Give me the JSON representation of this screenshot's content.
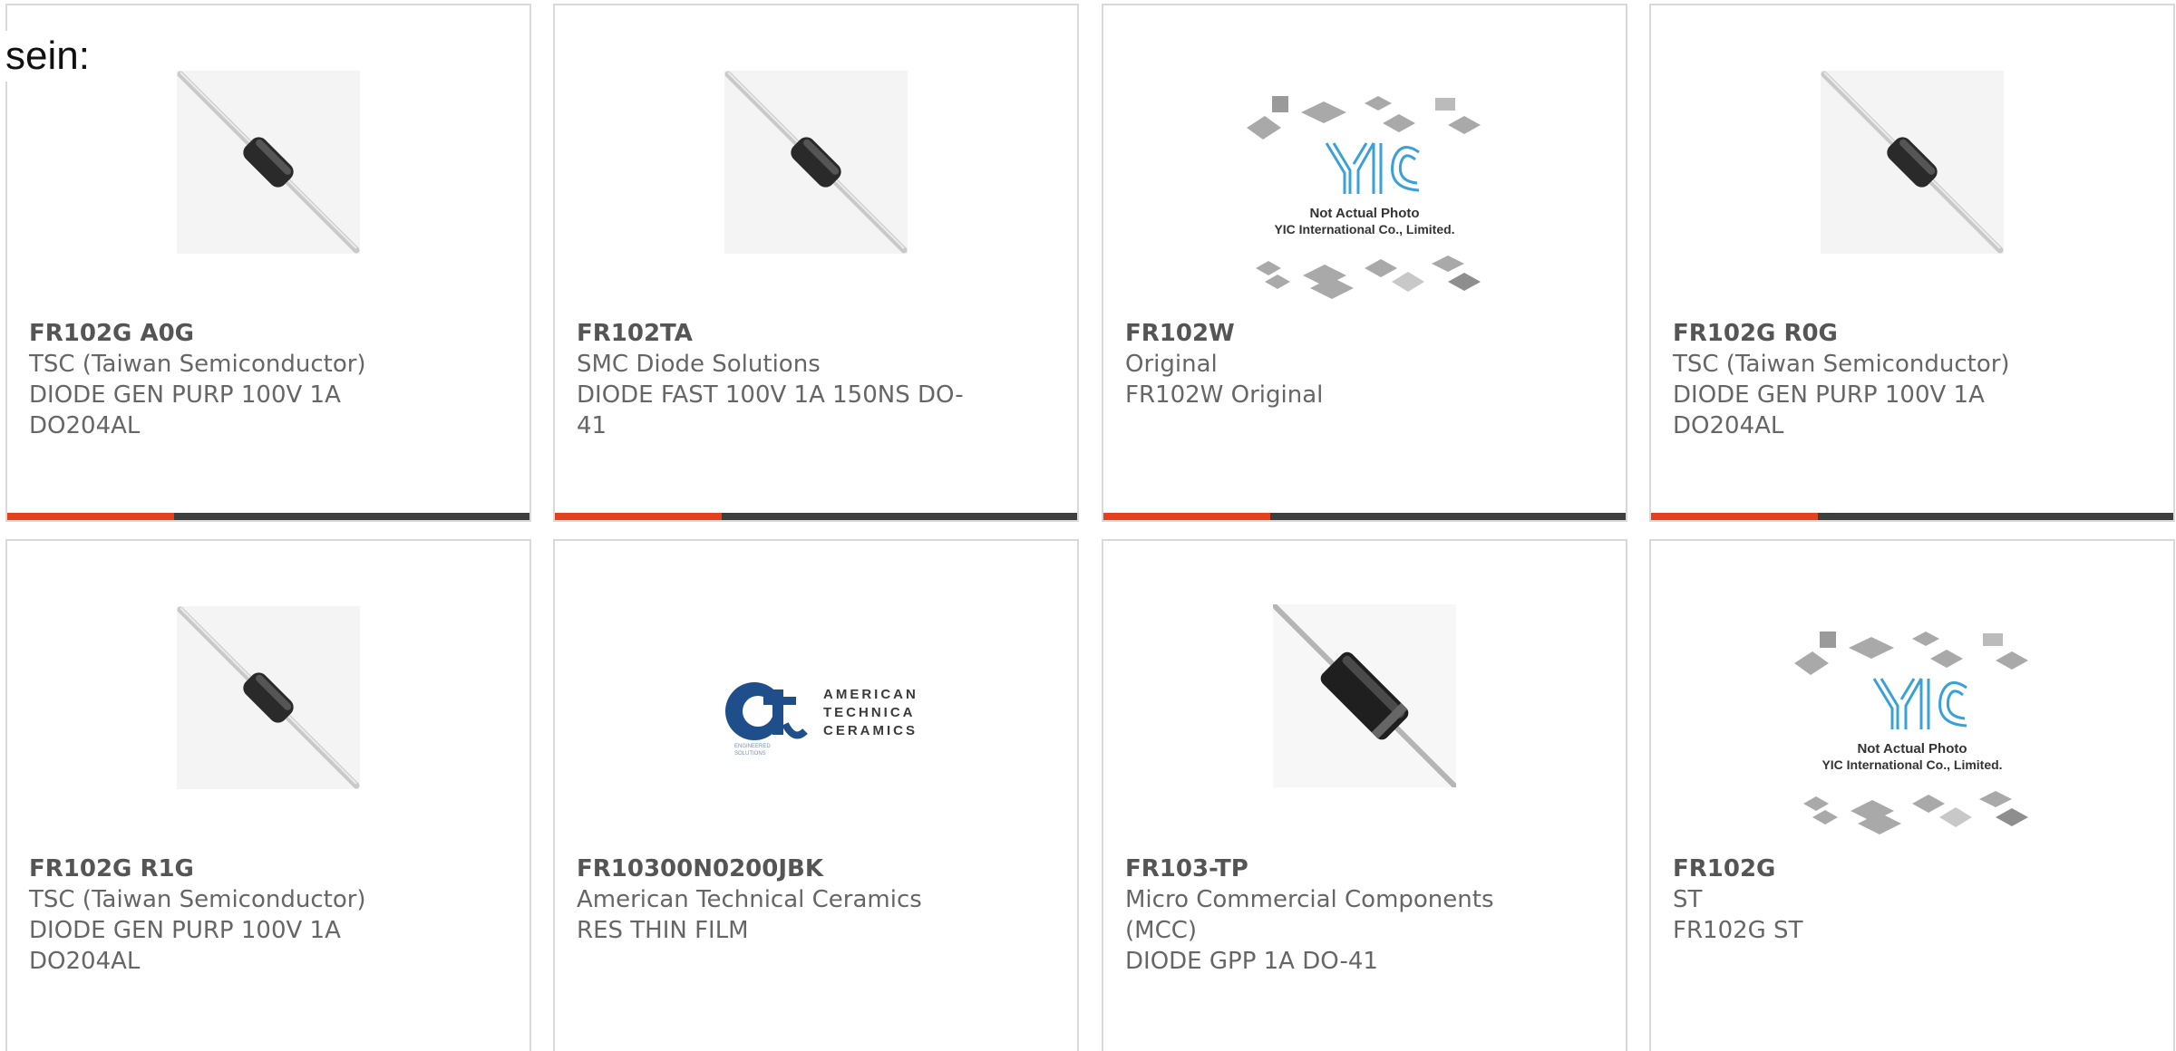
{
  "intro_text": "sein:",
  "colors": {
    "accent": "#e4421d",
    "bar": "#3e3e3e",
    "text": "#666666",
    "border": "#d9d9d9"
  },
  "products": [
    {
      "part": "FR102G A0G",
      "maker": "TSC (Taiwan Semiconductor)",
      "desc": "DIODE GEN PURP 100V 1A DO204AL",
      "image": "axial-diode-small"
    },
    {
      "part": "FR102TA",
      "maker": "SMC Diode Solutions",
      "desc": "DIODE FAST 100V 1A 150NS DO-41",
      "image": "axial-diode-small"
    },
    {
      "part": "FR102W",
      "maker": "Original",
      "desc": "FR102W Original",
      "image": "yic-placeholder"
    },
    {
      "part": "FR102G R0G",
      "maker": "TSC (Taiwan Semiconductor)",
      "desc": "DIODE GEN PURP 100V 1A DO204AL",
      "image": "axial-diode-small"
    },
    {
      "part": "FR102G R1G",
      "maker": "TSC (Taiwan Semiconductor)",
      "desc": "DIODE GEN PURP 100V 1A DO204AL",
      "image": "axial-diode-small"
    },
    {
      "part": "FR10300N0200JBK",
      "maker": "American Technical Ceramics",
      "desc": "RES THIN FILM",
      "image": "atc-logo"
    },
    {
      "part": "FR103-TP",
      "maker": "Micro Commercial Components (MCC)",
      "desc": "DIODE GPP 1A DO-41",
      "image": "axial-diode-large"
    },
    {
      "part": "FR102G",
      "maker": "ST",
      "desc": "FR102G ST",
      "image": "yic-placeholder"
    }
  ],
  "yic_placeholder": {
    "logo_text": "YIC",
    "line1": "Not Actual Photo",
    "line2": "YIC International Co., Limited."
  },
  "atc_logo": {
    "mark": "ac",
    "words": [
      "AMERICAN",
      "TECHNICAL",
      "CERAMICS"
    ]
  }
}
